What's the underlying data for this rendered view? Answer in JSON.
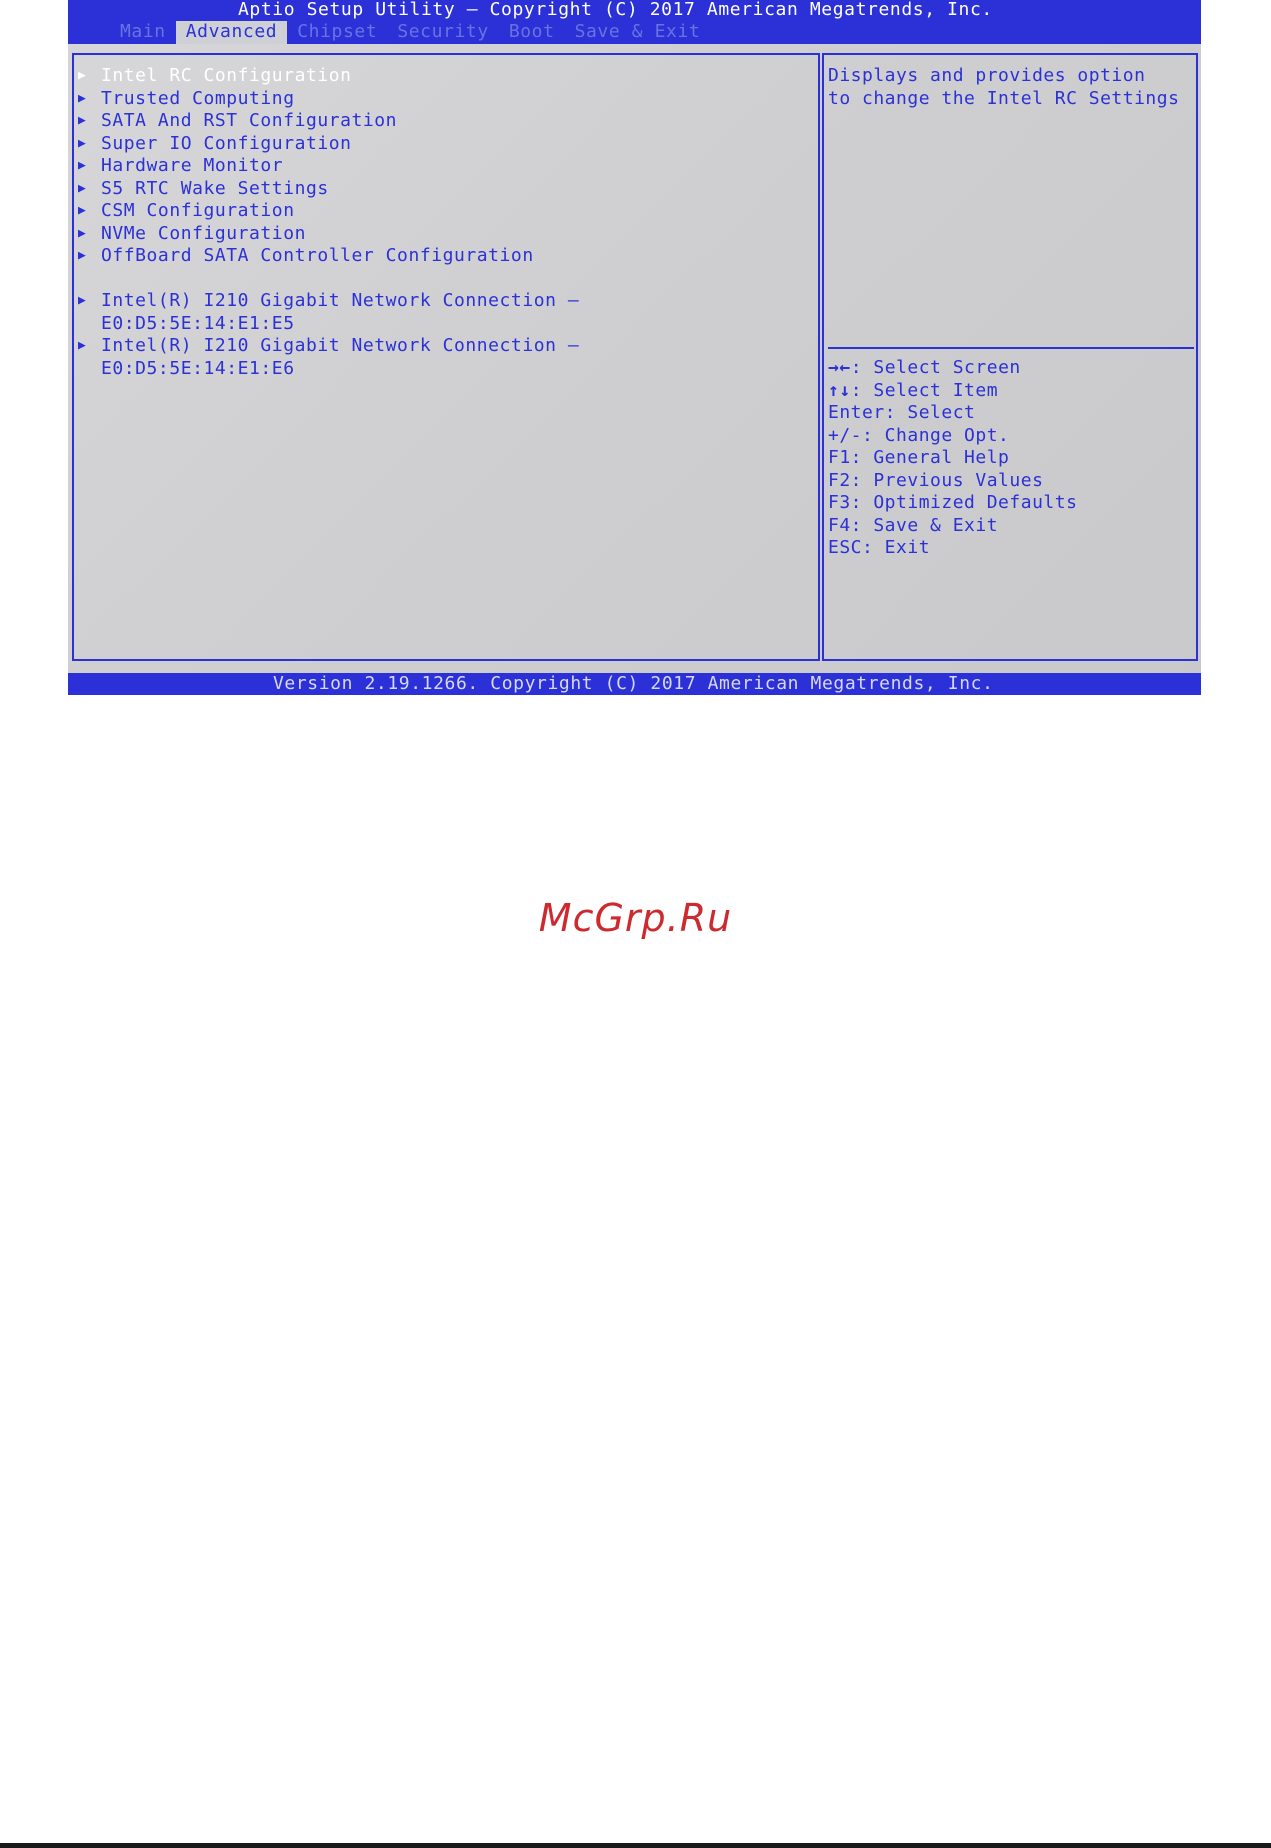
{
  "title": "Aptio Setup Utility – Copyright (C) 2017 American Megatrends, Inc.",
  "tabs": [
    {
      "label": "Main"
    },
    {
      "label": "Advanced"
    },
    {
      "label": "Chipset"
    },
    {
      "label": "Security"
    },
    {
      "label": "Boot"
    },
    {
      "label": "Save & Exit"
    }
  ],
  "active_tab": "Advanced",
  "menu": {
    "arrow": "▶",
    "items": [
      {
        "label": "Intel RC Configuration"
      },
      {
        "label": "Trusted Computing"
      },
      {
        "label": "SATA And RST Configuration"
      },
      {
        "label": "Super IO Configuration"
      },
      {
        "label": "Hardware Monitor"
      },
      {
        "label": "S5 RTC Wake Settings"
      },
      {
        "label": "CSM Configuration"
      },
      {
        "label": "NVMe Configuration"
      },
      {
        "label": "OffBoard SATA Controller Configuration"
      }
    ],
    "nics": [
      {
        "label": "Intel(R) I210 Gigabit  Network Connection –",
        "mac": "E0:D5:5E:14:E1:E5"
      },
      {
        "label": "Intel(R) I210 Gigabit  Network Connection –",
        "mac": "E0:D5:5E:14:E1:E6"
      }
    ]
  },
  "help": {
    "line1": "Displays and provides option",
    "line2": "to change the Intel RC Settings"
  },
  "keys": [
    {
      "key": "→←",
      "desc": ": Select Screen"
    },
    {
      "key": "↑↓",
      "desc": ": Select Item"
    },
    {
      "key": "",
      "desc": "Enter: Select"
    },
    {
      "key": "",
      "desc": "+/-: Change Opt."
    },
    {
      "key": "",
      "desc": "F1: General Help"
    },
    {
      "key": "",
      "desc": "F2: Previous Values"
    },
    {
      "key": "",
      "desc": "F3: Optimized Defaults"
    },
    {
      "key": "",
      "desc": "F4: Save & Exit"
    },
    {
      "key": "",
      "desc": "ESC: Exit"
    }
  ],
  "footer": "Version 2.19.1266. Copyright (C) 2017 American Megatrends, Inc.",
  "watermark": "McGrp.Ru",
  "colors": {
    "accent": "#2b31d6",
    "background": "#cfcfd1",
    "watermark": "#cc2a2f"
  }
}
